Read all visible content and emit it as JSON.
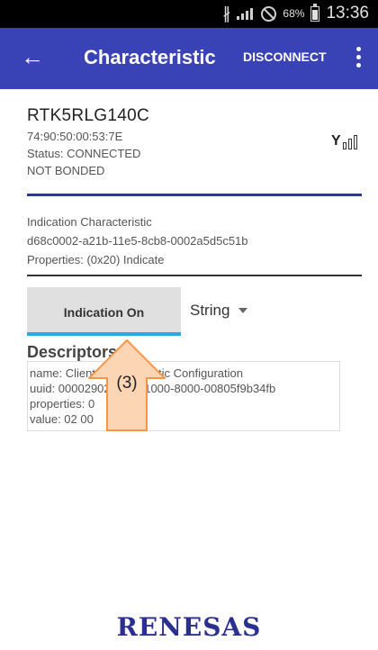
{
  "status_bar": {
    "battery_percent": "68%",
    "battery_level": 0.68,
    "time": "13:36",
    "icons": [
      "bluetooth-icon",
      "signal-muted-icon",
      "do-not-disturb-icon",
      "battery-icon"
    ]
  },
  "app_bar": {
    "title": "Characteristic",
    "disconnect_label": "DISCONNECT",
    "back_icon": "back-arrow-icon",
    "more_icon": "overflow-menu-icon",
    "color": "#3a43b6"
  },
  "device": {
    "name": "RTK5RLG140C",
    "address": "74:90:50:00:53:7E",
    "status": "Status:  CONNECTED",
    "bond_state": "NOT BONDED",
    "rssi_icon": "signal-strength-icon"
  },
  "characteristic": {
    "name": "Indication Characteristic",
    "uuid": "d68c0002-a21b-11e5-8cb8-0002a5d5c51b",
    "properties": "Properties: (0x20) Indicate"
  },
  "controls": {
    "indication_button": "Indication On",
    "format_selected": "String",
    "accent_color": "#2ea8e5"
  },
  "descriptors": {
    "title": "Descriptors",
    "lines": [
      "name: Client Characteristic Configuration",
      "uuid: 00002902-0000-1000-8000-00805f9b34fb",
      "properties: 0",
      "value: 02 00"
    ]
  },
  "callout": {
    "label": "(3)",
    "fill": "#fcd5b5",
    "stroke": "#f79646"
  },
  "brand": {
    "logo_text": "RENESAS",
    "color": "#2b2f8f"
  }
}
